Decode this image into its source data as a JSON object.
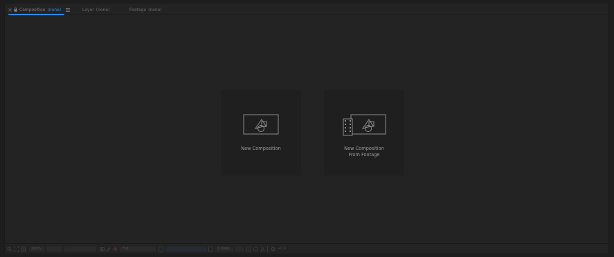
{
  "tabs": [
    {
      "name": "Composition",
      "state": "(none)",
      "active": true
    },
    {
      "name": "Layer",
      "state": "(none)",
      "active": false
    },
    {
      "name": "Footage",
      "state": "(none)",
      "active": false
    }
  ],
  "cards": {
    "new_composition": {
      "label_line1": "New Composition"
    },
    "from_footage": {
      "label_line1": "New Composition",
      "label_line2": "From Footage"
    }
  },
  "bottombar": {
    "zoom_value": "100%",
    "resolution_value": "Full",
    "camera_value": "1 View",
    "exposure_value": "+0.0"
  },
  "colors": {
    "accent": "#2d8ceb",
    "panel_bg": "#232323",
    "card_bg": "#1f1f1f"
  },
  "icons": {
    "close": "close-icon",
    "lock": "lock-icon",
    "menu": "panel-menu-icon",
    "composition": "composition-shapes-icon",
    "footage": "film-strip-icon"
  }
}
